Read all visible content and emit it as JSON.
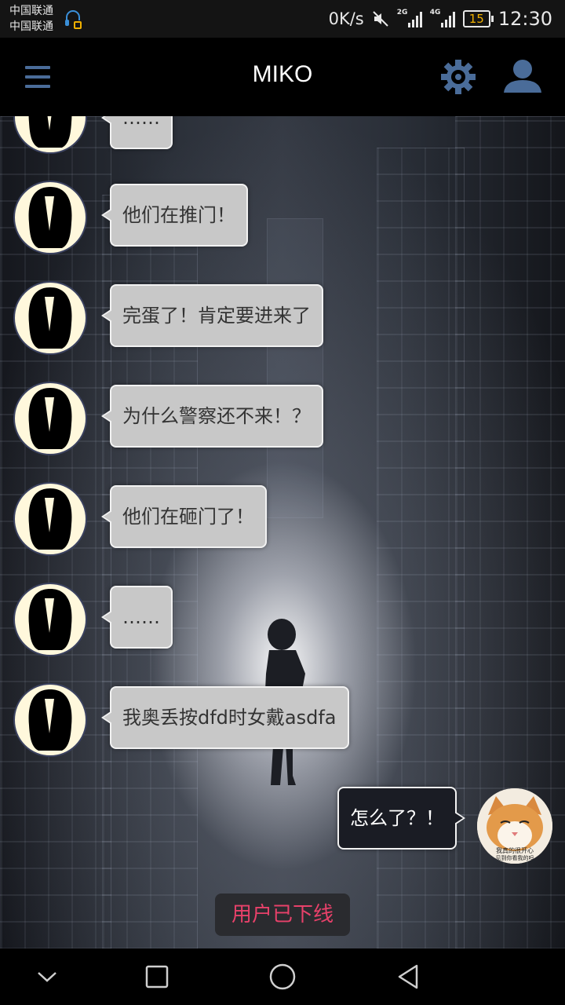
{
  "status_bar": {
    "carrier_1": "中国联通",
    "carrier_2": "中国联通",
    "net_speed": "0K/s",
    "signal_1_type": "2G",
    "signal_2_type": "4G",
    "battery": "15",
    "time": "12:30",
    "icons": [
      "headset-icon",
      "mute-icon",
      "signal-icon",
      "battery-icon"
    ]
  },
  "app_bar": {
    "title": "MIKO",
    "icons": [
      "menu-icon",
      "gear-icon",
      "user-icon"
    ],
    "accent_color": "#4a6c99"
  },
  "messages": [
    {
      "sender": "miko",
      "text": "……"
    },
    {
      "sender": "miko",
      "text": "他们在推门！"
    },
    {
      "sender": "miko",
      "text": "完蛋了！肯定要进来了"
    },
    {
      "sender": "miko",
      "text": "为什么警察还不来！？"
    },
    {
      "sender": "miko",
      "text": "他们在砸门了！"
    },
    {
      "sender": "miko",
      "text": "……"
    },
    {
      "sender": "miko",
      "text": "我奥丢按dfd时女戴asdfa"
    },
    {
      "sender": "me",
      "text": "怎么了？！"
    }
  ],
  "user_avatar": {
    "caption_1": "我真的很开心",
    "caption_2": "见到你看我的吗"
  },
  "toast": {
    "text": "用户已下线",
    "color": "#e8416a"
  },
  "nav_bar": {
    "icons": [
      "chevron-down-icon",
      "square-icon",
      "circle-icon",
      "back-triangle-icon"
    ]
  }
}
